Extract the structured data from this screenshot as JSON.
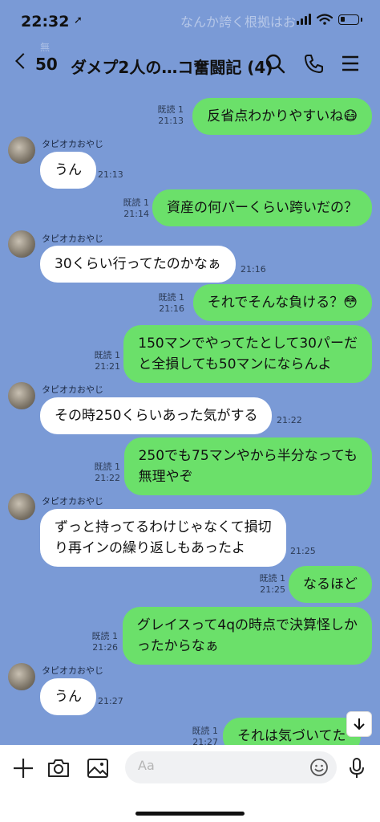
{
  "status": {
    "time": "22:32",
    "location_arrow": "➚",
    "ghost_banner": "なんか誇く根拠はお"
  },
  "header": {
    "back_count": "50",
    "title": "ダメプ2人の…コ奮闘記 (4)",
    "ghost_subtitle": "無"
  },
  "messages": [
    {
      "dir": "out",
      "text": "反省点わかりやすいね😷",
      "read": "既読 1",
      "time": "21:13"
    },
    {
      "dir": "in",
      "sender": "タピオカおやじ",
      "text": "うん",
      "time": "21:13"
    },
    {
      "dir": "out",
      "text": "資産の何パーくらい跨いだの？",
      "read": "既読 1",
      "time": "21:14"
    },
    {
      "dir": "in",
      "sender": "タピオカおやじ",
      "text": "30くらい行ってたのかなぁ",
      "time": "21:16"
    },
    {
      "dir": "out",
      "text": "それでそんな負ける？😳",
      "read": "既読 1",
      "time": "21:16"
    },
    {
      "dir": "out",
      "lines": [
        "150マンでやってたとして30パーだ",
        "と全損しても50マンにならんよ"
      ],
      "read": "既読 1",
      "time": "21:21"
    },
    {
      "dir": "in",
      "sender": "タピオカおやじ",
      "text": "その時250くらいあった気がする",
      "time": "21:22"
    },
    {
      "dir": "out",
      "lines": [
        "250でも75マンやから半分なっても",
        "無理やぞ"
      ],
      "read": "既読 1",
      "time": "21:22"
    },
    {
      "dir": "in",
      "sender": "タピオカおやじ",
      "lines": [
        "ずっと持ってるわけじゃなくて損切",
        "り再インの繰り返しもあったよ"
      ],
      "time": "21:25"
    },
    {
      "dir": "out",
      "text": "なるほど",
      "read": "既読 1",
      "time": "21:25"
    },
    {
      "dir": "out",
      "lines": [
        "グレイスって4qの時点で決算怪しか",
        "ったからなぁ"
      ],
      "read": "既読 1",
      "time": "21:26"
    },
    {
      "dir": "in",
      "sender": "タピオカおやじ",
      "text": "うん",
      "time": "21:27"
    },
    {
      "dir": "out",
      "text": "それは気づいてた",
      "read": "既読 1",
      "time": "21:27"
    }
  ],
  "input": {
    "placeholder": "Aa"
  },
  "icons": {
    "back": "chevron-left-icon",
    "search": "search-icon",
    "call": "phone-icon",
    "menu": "menu-icon",
    "add": "plus-icon",
    "camera": "camera-icon",
    "image": "image-icon",
    "emoji": "emoji-icon",
    "mic": "microphone-icon",
    "scroll": "arrow-down-icon"
  },
  "colors": {
    "chat_background": "#7a9ad6",
    "outgoing_bubble": "#6be06a",
    "incoming_bubble": "#ffffff"
  }
}
